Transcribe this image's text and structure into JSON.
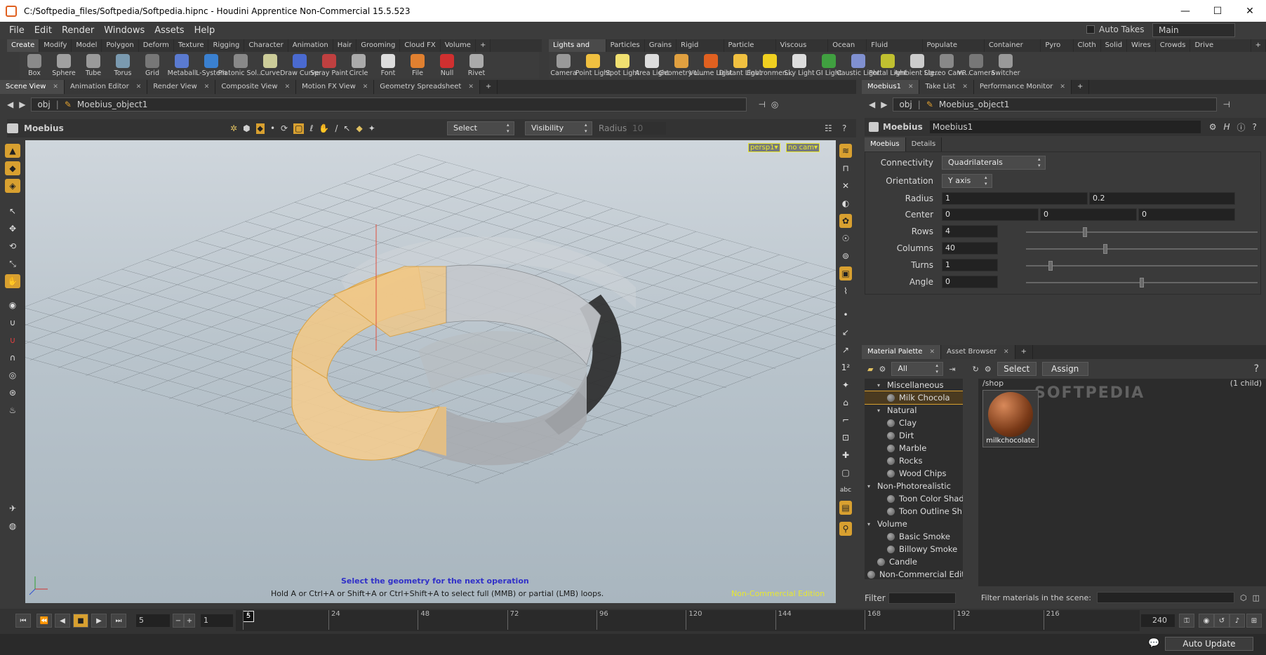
{
  "window": {
    "title": "C:/Softpedia_files/Softpedia/Softpedia.hipnc - Houdini Apprentice Non-Commercial 15.5.523",
    "min": "—",
    "max": "☐",
    "close": "✕"
  },
  "menu": [
    "File",
    "Edit",
    "Render",
    "Windows",
    "Assets",
    "Help"
  ],
  "auto_takes": "Auto Takes",
  "desktop": "Main",
  "shelf_left_tabs": [
    "Create",
    "Modify",
    "Model",
    "Polygon",
    "Deform",
    "Texture",
    "Rigging",
    "Character",
    "Animation",
    "Hair",
    "Grooming",
    "Cloud FX",
    "Volume"
  ],
  "shelf_left_tools": [
    "Box",
    "Sphere",
    "Tube",
    "Torus",
    "Grid",
    "Metaball",
    "L-System",
    "Platonic Sol...",
    "Curve",
    "Draw Curve",
    "Spray Paint",
    "Circle",
    "Font",
    "File",
    "Null",
    "Rivet"
  ],
  "shelf_right_tabs": [
    "Lights and Ca...",
    "Particles",
    "Grains",
    "Rigid Bodies",
    "Particle Fluids",
    "Viscous Fluids",
    "Ocean FX",
    "Fluid Contain...",
    "Populate Conta...",
    "Container Tools",
    "Pyro FX",
    "Cloth",
    "Solid",
    "Wires",
    "Crowds",
    "Drive Simulation"
  ],
  "shelf_right_tools": [
    "Camera",
    "Point Light",
    "Spot Light",
    "Area Light",
    "Geometry L...",
    "Volume Light",
    "Distant Light",
    "Environmen...",
    "Sky Light",
    "GI Light",
    "Caustic Light",
    "Portal Light",
    "Ambient Lig...",
    "Stereo Cam...",
    "VR Camera",
    "Switcher"
  ],
  "left_pane_tabs": [
    "Scene View",
    "Animation Editor",
    "Render View",
    "Composite View",
    "Motion FX View",
    "Geometry Spreadsheet"
  ],
  "path": {
    "root": "obj",
    "node": "Moebius_object1"
  },
  "viewport": {
    "op_name": "Moebius",
    "select_mode": "Select",
    "visibility": "Visibility",
    "radius_label": "Radius",
    "radius_value": "10",
    "camera_persp": "persp1▾",
    "camera_cam": "no cam▾",
    "prompt": "Select the geometry for the next operation",
    "hint": "Hold A or Ctrl+A or Shift+A or Ctrl+Shift+A to select full (MMB) or partial (LMB) loops.",
    "watermark": "Non-Commercial Edition"
  },
  "right_pane_tabs": [
    "Moebius1",
    "Take List",
    "Performance Monitor"
  ],
  "params": {
    "type": "Moebius",
    "name": "Moebius1",
    "tabs": [
      "Moebius",
      "Details"
    ],
    "connectivity_label": "Connectivity",
    "connectivity": "Quadrilaterals",
    "orientation_label": "Orientation",
    "orientation": "Y axis",
    "radius_label": "Radius",
    "radius": [
      "1",
      "0.2"
    ],
    "center_label": "Center",
    "center": [
      "0",
      "0",
      "0"
    ],
    "rows_label": "Rows",
    "rows": "4",
    "rows_fraction": 0.25,
    "columns_label": "Columns",
    "columns": "40",
    "columns_fraction": 0.34,
    "turns_label": "Turns",
    "turns": "1",
    "turns_fraction": 0.1,
    "angle_label": "Angle",
    "angle": "0",
    "angle_fraction": 0.5
  },
  "material_tabs": [
    "Material Palette",
    "Asset Browser"
  ],
  "material": {
    "filter_mode": "All",
    "select": "Select",
    "assign": "Assign",
    "shop_path": "/shop",
    "child_count": "(1 child)",
    "shop_item": "milkchocolate",
    "filter_label": "Filter",
    "filter_scene_label": "Filter materials in the scene:",
    "watermark": "SOFTPEDIA",
    "tree": [
      {
        "label": "Miscellaneous",
        "kind": "group",
        "indent": 1
      },
      {
        "label": "Milk Chocola",
        "kind": "item",
        "indent": 2,
        "selected": true
      },
      {
        "label": "Natural",
        "kind": "group",
        "indent": 1
      },
      {
        "label": "Clay",
        "kind": "item",
        "indent": 2
      },
      {
        "label": "Dirt",
        "kind": "item",
        "indent": 2
      },
      {
        "label": "Marble",
        "kind": "item",
        "indent": 2
      },
      {
        "label": "Rocks",
        "kind": "item",
        "indent": 2
      },
      {
        "label": "Wood Chips",
        "kind": "item",
        "indent": 2
      },
      {
        "label": "Non-Photorealistic",
        "kind": "group",
        "indent": 0
      },
      {
        "label": "Toon Color Shad",
        "kind": "item",
        "indent": 2
      },
      {
        "label": "Toon Outline Sh",
        "kind": "item",
        "indent": 2
      },
      {
        "label": "Volume",
        "kind": "group",
        "indent": 0
      },
      {
        "label": "Basic Smoke",
        "kind": "item",
        "indent": 2
      },
      {
        "label": "Billowy Smoke",
        "kind": "item",
        "indent": 2
      },
      {
        "label": "Candle",
        "kind": "item",
        "indent": 1
      },
      {
        "label": "Non-Commercial Edition",
        "kind": "item",
        "indent": 0
      }
    ]
  },
  "timeline": {
    "current_frame": "5",
    "start_frame": "1",
    "end_frame": "240",
    "marker": "5",
    "ticks": [
      "1",
      "24",
      "48",
      "72",
      "96",
      "120",
      "144",
      "168",
      "192",
      "216"
    ]
  },
  "status": {
    "auto_update": "Auto Update"
  },
  "colors": {
    "accent": "#d8a030",
    "selected_geo": "#f0c888",
    "prompt_blue": "#3030c8",
    "watermark_yellow": "#e8e830"
  }
}
